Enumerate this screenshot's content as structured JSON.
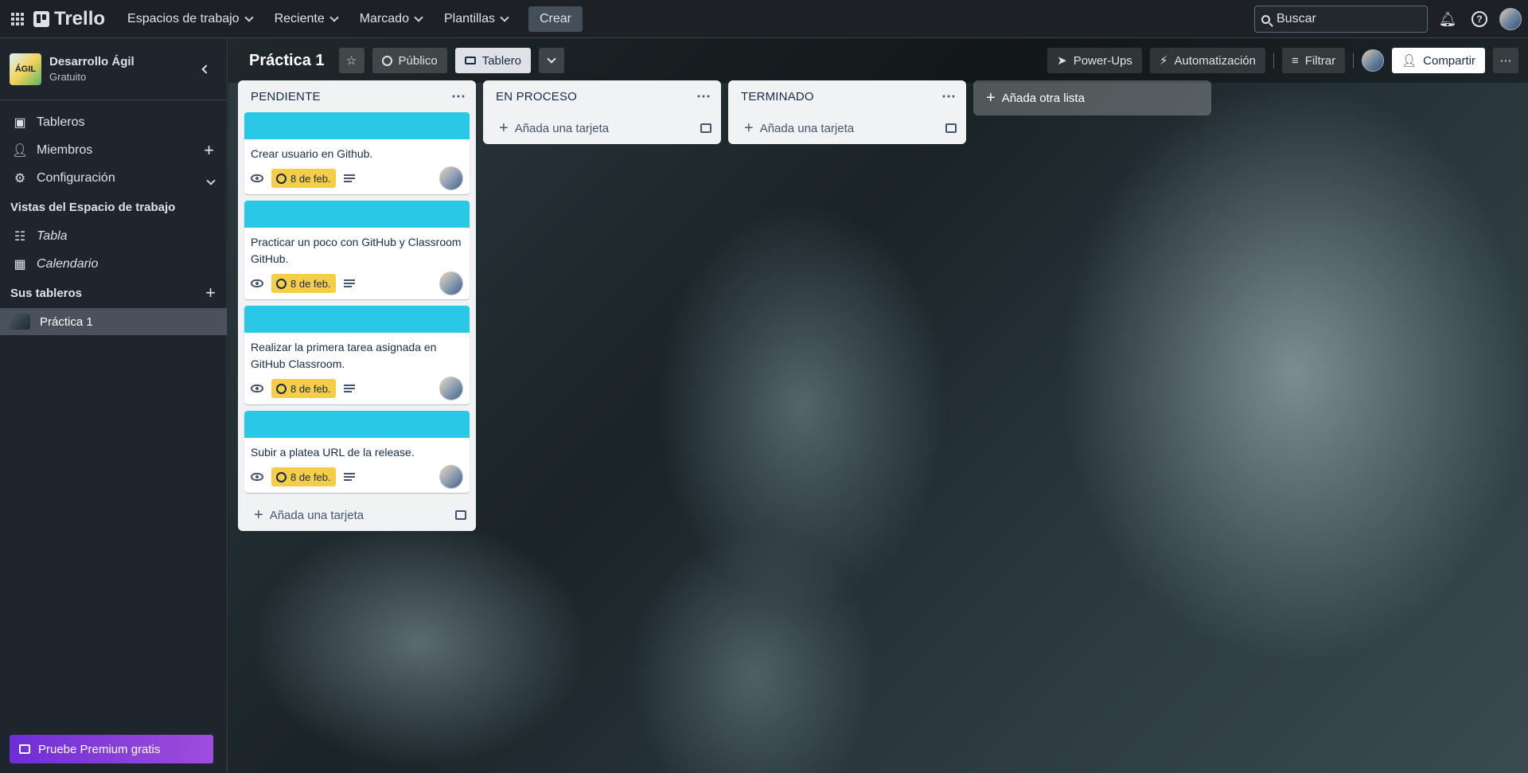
{
  "topnav": {
    "logo": "Trello",
    "menus": [
      "Espacios de trabajo",
      "Reciente",
      "Marcado",
      "Plantillas"
    ],
    "create": "Crear",
    "search_placeholder": "Buscar"
  },
  "sidebar": {
    "workspace_name": "Desarrollo Ágil",
    "workspace_plan": "Gratuito",
    "workspace_logo_text": "ÁGIL",
    "items": [
      {
        "label": "Tableros",
        "icon": "board-icon"
      },
      {
        "label": "Miembros",
        "icon": "person-icon"
      },
      {
        "label": "Configuración",
        "icon": "gear-icon"
      }
    ],
    "views_title": "Vistas del Espacio de trabajo",
    "views": [
      {
        "label": "Tabla",
        "icon": "table-icon"
      },
      {
        "label": "Calendario",
        "icon": "calendar-icon"
      }
    ],
    "boards_title": "Sus tableros",
    "boards": [
      {
        "label": "Práctica 1"
      }
    ],
    "premium": "Pruebe Premium gratis"
  },
  "board": {
    "name": "Práctica 1",
    "visibility": "Público",
    "view": "Tablero",
    "powerups": "Power-Ups",
    "automation": "Automatización",
    "filter": "Filtrar",
    "share": "Compartir",
    "add_list": "Añada otra lista"
  },
  "lists": [
    {
      "title": "PENDIENTE",
      "cards": [
        {
          "title": "Crear usuario en Github.",
          "due": "8 de feb."
        },
        {
          "title": "Practicar un poco con GitHub y Classroom GitHub.",
          "due": "8 de feb."
        },
        {
          "title": "Realizar la primera tarea asignada en GitHub Classroom.",
          "due": "8 de feb."
        },
        {
          "title": "Subir a platea URL de la release.",
          "due": "8 de feb."
        }
      ],
      "add_card": "Añada una tarjeta"
    },
    {
      "title": "EN PROCESO",
      "cards": [],
      "add_card": "Añada una tarjeta"
    },
    {
      "title": "TERMINADO",
      "cards": [],
      "add_card": "Añada una tarjeta"
    }
  ],
  "colors": {
    "card_cover": "#29c8e6",
    "due_badge": "#f5cd47",
    "premium": "#8f3fd8"
  }
}
